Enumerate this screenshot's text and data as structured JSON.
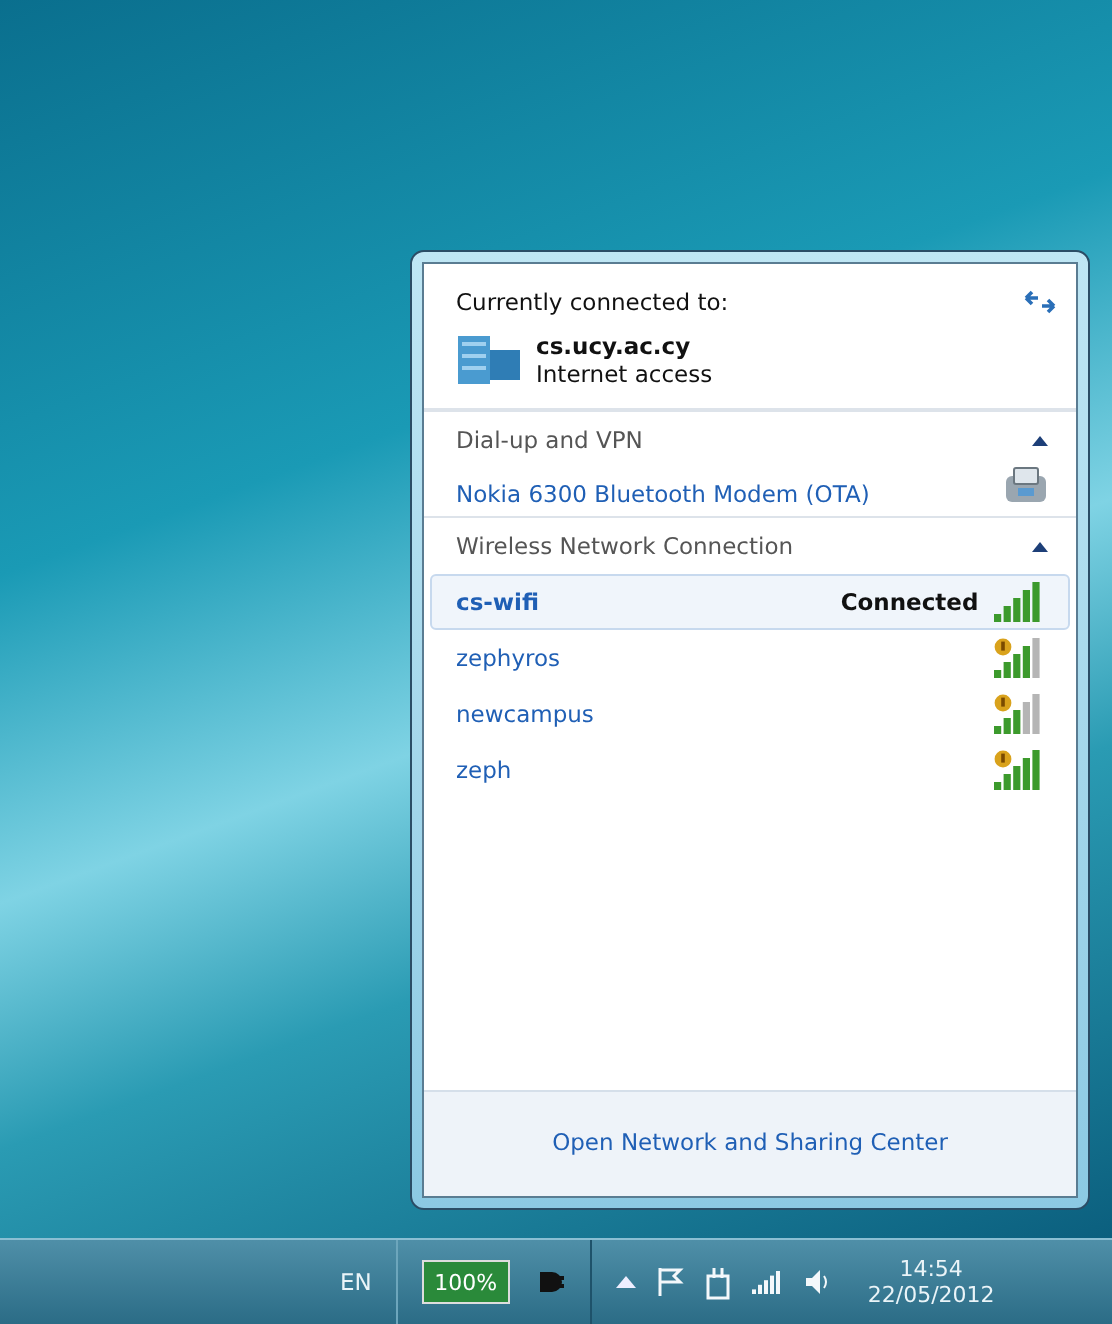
{
  "current": {
    "heading": "Currently connected to:",
    "network": "cs.ucy.ac.cy",
    "access": "Internet access"
  },
  "sections": [
    {
      "kind": "dialup",
      "title": "Dial-up and VPN",
      "expanded": true,
      "items": [
        {
          "name": "Nokia 6300 Bluetooth Modem (OTA)"
        }
      ]
    },
    {
      "kind": "wireless",
      "title": "Wireless Network Connection",
      "expanded": true,
      "items": [
        {
          "name": "cs-wifi",
          "status": "Connected",
          "selected": true,
          "secured": false,
          "level": 1
        },
        {
          "name": "zephyros",
          "selected": false,
          "secured": true,
          "level": 0.8
        },
        {
          "name": "newcampus",
          "selected": false,
          "secured": true,
          "level": 0.6
        },
        {
          "name": "zeph",
          "selected": false,
          "secured": true,
          "level": 1
        }
      ]
    }
  ],
  "footer_link": "Open Network and Sharing Center",
  "taskbar": {
    "language": "EN",
    "battery": {
      "label": "100%",
      "level": 1
    },
    "time": "14:54",
    "date": "22/05/2012"
  }
}
